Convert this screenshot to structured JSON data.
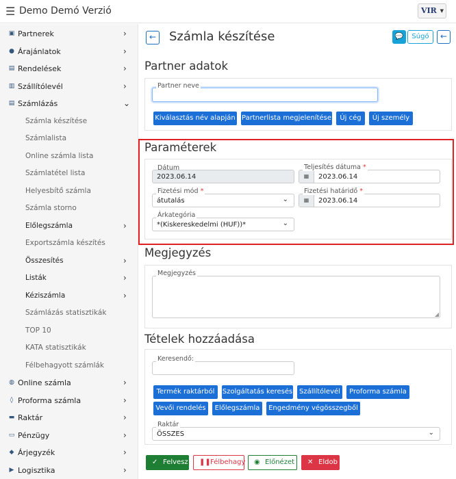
{
  "app": {
    "title": "Demo Demó Verzió",
    "logo_text": "VIR"
  },
  "sidebar": {
    "items": [
      {
        "label": "Partnerek",
        "icon": "contact-icon",
        "chevron": "›"
      },
      {
        "label": "Árajánlatok",
        "icon": "chat-icon",
        "chevron": "›"
      },
      {
        "label": "Rendelések",
        "icon": "doc-icon",
        "chevron": "›"
      },
      {
        "label": "Szállítólevél",
        "icon": "clipboard-icon",
        "chevron": "›"
      },
      {
        "label": "Számlázás",
        "icon": "invoice-icon",
        "chevron": "⌄"
      },
      {
        "label": "Számla készítése"
      },
      {
        "label": "Számlalista"
      },
      {
        "label": "Online számla lista"
      },
      {
        "label": "Számlatétel lista"
      },
      {
        "label": "Helyesbítő számla"
      },
      {
        "label": "Számla storno"
      },
      {
        "label": "Előlegszámla",
        "chevron": "›"
      },
      {
        "label": "Exportszámla készítés"
      },
      {
        "label": "Összesítés",
        "chevron": "›"
      },
      {
        "label": "Listák",
        "chevron": "›"
      },
      {
        "label": "Kéziszámla",
        "chevron": "›"
      },
      {
        "label": "Számlázás statisztikák"
      },
      {
        "label": "TOP 10"
      },
      {
        "label": "KATA statisztikák"
      },
      {
        "label": "Félbehagyott számlák"
      },
      {
        "label": "Online számla",
        "icon": "globe-icon",
        "chevron": "›"
      },
      {
        "label": "Proforma számla",
        "icon": "tag-icon",
        "chevron": "›"
      },
      {
        "label": "Raktár",
        "icon": "warehouse-icon",
        "chevron": "›"
      },
      {
        "label": "Pénzügy",
        "icon": "money-icon",
        "chevron": "›"
      },
      {
        "label": "Árjegyzék",
        "icon": "pricetag-icon",
        "chevron": "›"
      },
      {
        "label": "Logisztika",
        "icon": "truck-icon",
        "chevron": "›"
      }
    ]
  },
  "header": {
    "title": "Számla készítése",
    "help_label": "Súgó",
    "back_icon": "←"
  },
  "partner": {
    "section_title": "Partner adatok",
    "name_label": "Partner neve",
    "name_value": "",
    "buttons": [
      "Kiválasztás név alapján",
      "Partnerlista megjelenítése",
      "Új cég",
      "Új személy"
    ]
  },
  "params": {
    "section_title": "Paraméterek",
    "datum_label": "Dátum",
    "datum_value": "2023.06.14",
    "teljesites_label": "Teljesítés dátuma",
    "teljesites_value": "2023.06.14",
    "fizetesi_mod_label": "Fizetési mód",
    "fizetesi_mod_value": "átutalás",
    "hatarido_label": "Fizetési határidő",
    "hatarido_value": "2023.06.14",
    "arkategoria_label": "Árkategória",
    "arkategoria_value": "*(Kiskereskedelmi (HUF))*",
    "required_mark": "*"
  },
  "megjegyzes": {
    "section_title": "Megjegyzés",
    "label": "Megjegyzés",
    "value": ""
  },
  "tetelek": {
    "section_title": "Tételek hozzáadása",
    "search_label": "Keresendő:",
    "search_value": "",
    "buttons_row1": [
      "Termék raktárból",
      "Szolgáltatás keresés",
      "Szállítólevél",
      "Proforma számla"
    ],
    "buttons_row2": [
      "Vevői rendelés",
      "Előlegszámla",
      "Engedmény végösszegből"
    ],
    "raktar_label": "Raktár",
    "raktar_value": "ÖSSZES"
  },
  "actions": {
    "felvesz": "Felvesz",
    "felbehagy": "Félbehagy",
    "elonezet": "Előnézet",
    "eldob": "Eldob"
  },
  "colors": {
    "primary": "#1b6fd6",
    "success": "#1e7e34",
    "danger": "#dc3545",
    "highlight": "#e02020",
    "help": "#17a2d8"
  }
}
